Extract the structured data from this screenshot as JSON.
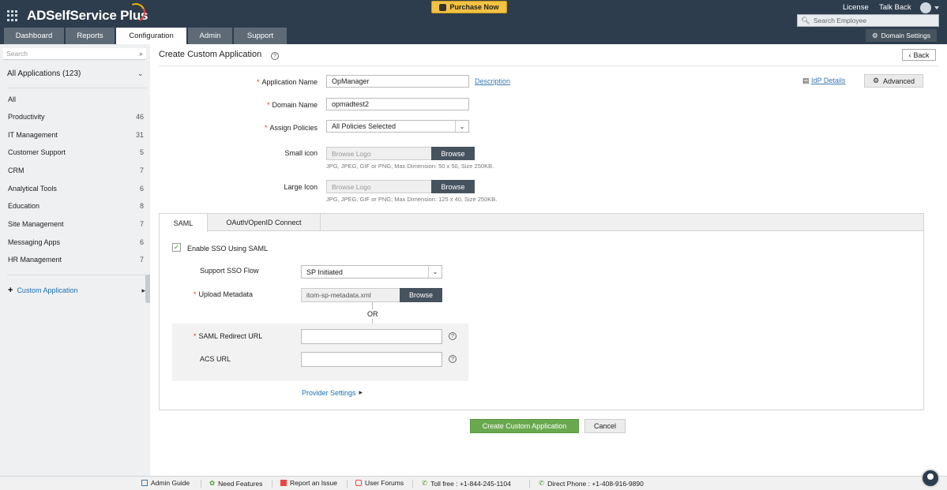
{
  "header": {
    "logo": "ADSelfService Plus",
    "purchase": "Purchase Now",
    "license": "License",
    "talk_back": "Talk Back",
    "search_placeholder": "Search Employee",
    "domain_settings": "Domain Settings",
    "tabs": [
      {
        "label": "Dashboard",
        "active": false
      },
      {
        "label": "Reports",
        "active": false
      },
      {
        "label": "Configuration",
        "active": true
      },
      {
        "label": "Admin",
        "active": false
      },
      {
        "label": "Support",
        "active": false
      }
    ]
  },
  "sidebar": {
    "search_placeholder": "Search",
    "title": "All Applications (123)",
    "items": [
      {
        "label": "All",
        "count": ""
      },
      {
        "label": "Productivity",
        "count": "46"
      },
      {
        "label": "IT Management",
        "count": "31"
      },
      {
        "label": "Customer Support",
        "count": "5"
      },
      {
        "label": "CRM",
        "count": "7"
      },
      {
        "label": "Analytical Tools",
        "count": "6"
      },
      {
        "label": "Education",
        "count": "8"
      },
      {
        "label": "Site Management",
        "count": "7"
      },
      {
        "label": "Messaging Apps",
        "count": "6"
      },
      {
        "label": "HR Management",
        "count": "7"
      }
    ],
    "custom_app": "Custom Application"
  },
  "main": {
    "title": "Create Custom Application",
    "back": "Back",
    "idp_details": "IdP Details",
    "advanced": "Advanced",
    "app_name_label": "Application Name",
    "app_name_value": "OpManager",
    "description_link": "Description",
    "domain_label": "Domain Name",
    "domain_value": "opmadtest2",
    "policies_label": "Assign Policies",
    "policies_value": "All Policies Selected",
    "small_icon_label": "Small icon",
    "large_icon_label": "Large Icon",
    "browse_logo": "Browse Logo",
    "browse": "Browse",
    "small_hint": "JPG, JPEG, GIF or PNG; Max Dimension: 50 x 50, Size 250KB.",
    "large_hint": "JPG, JPEG, GIF or PNG; Max Dimension: 125 x 40, Size 250KB."
  },
  "protocol": {
    "tabs": [
      "SAML",
      "OAuth/OpenID Connect"
    ],
    "enable_sso": "Enable SSO Using SAML",
    "sso_flow_label": "Support SSO Flow",
    "sso_flow_value": "SP Initiated",
    "metadata_label": "Upload Metadata",
    "metadata_value": "itom-sp-metadata.xml",
    "or": "OR",
    "redirect_label": "SAML Redirect URL",
    "acs_label": "ACS URL",
    "provider_settings": "Provider Settings"
  },
  "actions": {
    "create": "Create Custom Application",
    "cancel": "Cancel"
  },
  "footer": {
    "admin_guide": "Admin Guide",
    "need_features": "Need Features",
    "report_issue": "Report an Issue",
    "user_forums": "User Forums",
    "toll_free": "Toll free : +1-844-245-1104",
    "direct_phone": "Direct Phone : +1-408-916-9890"
  },
  "colors": {
    "header_bg": "#2e3d4d",
    "accent_green": "#6aa84f",
    "link_blue": "#3b78b5",
    "required_red": "#e33333",
    "purchase_yellow": "#f4c242"
  }
}
